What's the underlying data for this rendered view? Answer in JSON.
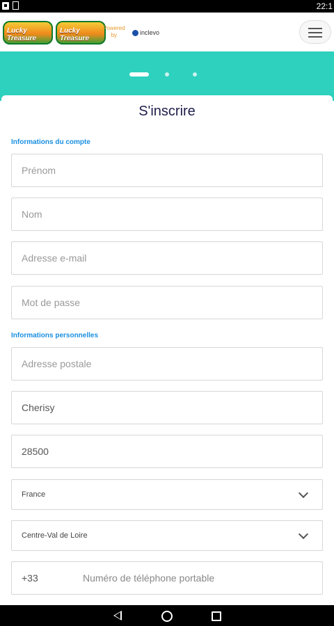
{
  "status_bar": {
    "time": "22:1"
  },
  "header": {
    "logo_text": "Lucky Treasure",
    "powered_label": "Powered",
    "powered_by": "by",
    "brand": "inclevo"
  },
  "form": {
    "title": "S'inscrire",
    "section_account": "Informations du compte",
    "section_personal": "Informations personnelles",
    "fields": {
      "first_name": "Prénom",
      "last_name": "Nom",
      "email": "Adresse e-mail",
      "password": "Mot de passe",
      "address": "Adresse postale",
      "city": "Cherisy",
      "postal_code": "28500",
      "country": "France",
      "region": "Centre-Val de Loire",
      "phone_prefix": "+33",
      "phone_placeholder": "Numéro de téléphone portable"
    }
  },
  "colors": {
    "banner": "#2ed0be",
    "section_label": "#1a8fe0",
    "title": "#1e1e4b"
  }
}
